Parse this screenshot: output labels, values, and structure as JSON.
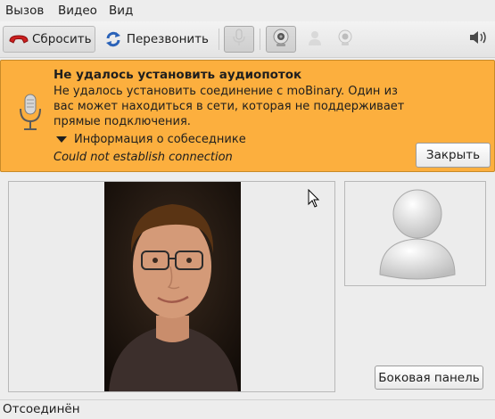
{
  "menu": {
    "call": "Вызов",
    "video": "Видео",
    "view": "Вид"
  },
  "toolbar": {
    "hangup_label": "Сбросить",
    "redial_label": "Перезвонить",
    "icons": [
      "hangup-icon",
      "redial-icon",
      "microphone-icon",
      "webcam-icon",
      "contact-icon",
      "webcam-preview-icon",
      "volume-icon"
    ]
  },
  "infobar": {
    "title": "Не удалось установить аудиопоток",
    "message": "Не удалось установить соединение с moBinary. Один из вас может находиться в сети, которая не поддерживает прямые подключения.",
    "expander": "Информация о собеседнике",
    "detail": "Could not establish connection",
    "close_label": "Закрыть",
    "bg_color": "#fcaf3e"
  },
  "side_panel_label": "Боковая панель",
  "status": "Отсоединён"
}
